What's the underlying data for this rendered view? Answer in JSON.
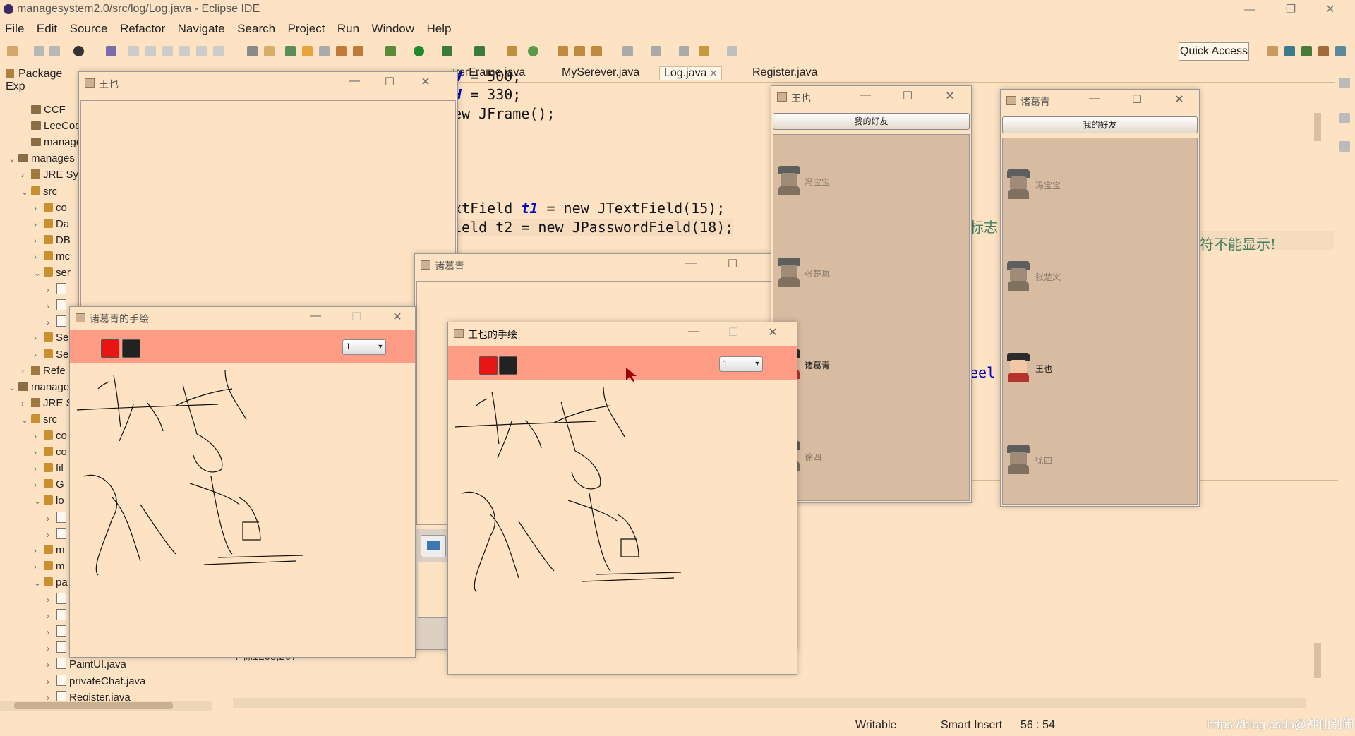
{
  "window": {
    "title": "managesystem2.0/src/log/Log.java - Eclipse IDE",
    "controls": [
      "—",
      "❐",
      "✕"
    ]
  },
  "menu": [
    "File",
    "Edit",
    "Source",
    "Refactor",
    "Navigate",
    "Search",
    "Project",
    "Run",
    "Window",
    "Help"
  ],
  "toolbar": {
    "quick_access": "Quick Access"
  },
  "package_explorer": {
    "tab_label": "Package Exp",
    "rows": [
      {
        "twisty": "",
        "icon": "proj",
        "label": "CCF"
      },
      {
        "twisty": "",
        "icon": "proj",
        "label": "LeeCode"
      },
      {
        "twisty": "",
        "icon": "proj",
        "label": "manages"
      },
      {
        "twisty": "⌄",
        "icon": "proj",
        "label": "manages"
      },
      {
        "twisty": "›",
        "icon": "jar",
        "label": "JRE Sy"
      },
      {
        "twisty": "⌄",
        "icon": "pkg",
        "label": "src"
      },
      {
        "twisty": "›",
        "icon": "pkg",
        "label": "co"
      },
      {
        "twisty": "›",
        "icon": "pkg",
        "label": "Da"
      },
      {
        "twisty": "›",
        "icon": "pkg",
        "label": "DB"
      },
      {
        "twisty": "›",
        "icon": "pkg",
        "label": "mc"
      },
      {
        "twisty": "⌄",
        "icon": "pkg",
        "label": "ser"
      },
      {
        "twisty": "›",
        "icon": "java",
        "label": ""
      },
      {
        "twisty": "›",
        "icon": "java",
        "label": ""
      },
      {
        "twisty": "›",
        "icon": "java",
        "label": ""
      },
      {
        "twisty": "›",
        "icon": "pkg",
        "label": "Se"
      },
      {
        "twisty": "›",
        "icon": "pkg",
        "label": "Se"
      },
      {
        "twisty": "›",
        "icon": "jar",
        "label": "Refe"
      },
      {
        "twisty": "⌄",
        "icon": "proj",
        "label": "manage"
      },
      {
        "twisty": "›",
        "icon": "jar",
        "label": "JRE S"
      },
      {
        "twisty": "⌄",
        "icon": "pkg",
        "label": "src"
      },
      {
        "twisty": "›",
        "icon": "pkg",
        "label": "co"
      },
      {
        "twisty": "›",
        "icon": "pkg",
        "label": "co"
      },
      {
        "twisty": "›",
        "icon": "pkg",
        "label": "fil"
      },
      {
        "twisty": "›",
        "icon": "pkg",
        "label": "G"
      },
      {
        "twisty": "⌄",
        "icon": "pkg",
        "label": "lo"
      },
      {
        "twisty": "›",
        "icon": "java",
        "label": ""
      },
      {
        "twisty": "›",
        "icon": "java",
        "label": ""
      },
      {
        "twisty": "›",
        "icon": "pkg",
        "label": "m"
      },
      {
        "twisty": "›",
        "icon": "pkg",
        "label": "m"
      },
      {
        "twisty": "⌄",
        "icon": "pkg",
        "label": "pa"
      },
      {
        "twisty": "›",
        "icon": "java",
        "label": ""
      },
      {
        "twisty": "›",
        "icon": "java",
        "label": ""
      },
      {
        "twisty": "›",
        "icon": "java",
        "label": ""
      },
      {
        "twisty": "›",
        "icon": "java",
        "label": ""
      },
      {
        "twisty": "›",
        "icon": "java",
        "label": "PaintUI.java"
      },
      {
        "twisty": "›",
        "icon": "java",
        "label": "privateChat.java"
      },
      {
        "twisty": "›",
        "icon": "java",
        "label": "Register.java"
      }
    ]
  },
  "editor": {
    "tabs": [
      "verFrame.java",
      "MySerever.java",
      "Log.java",
      "Register.java"
    ],
    "active_tab": "Log.java",
    "lines": [
      {
        "pre": "",
        "fld": "W",
        "post": " = 500;"
      },
      {
        "pre": "",
        "fld": "H",
        "post": " = 330;"
      },
      {
        "pre": "ew JFrame();",
        "fld": "",
        "post": ""
      },
      {
        "pre": "xtField ",
        "fld": "t1",
        "post": " = new JTextField(15);"
      },
      {
        "pre": "ield t2 = new JPasswordField(18);",
        "fld": "",
        "post": ""
      },
      {
        "pre": "eel",
        "fld": "",
        "post": ""
      }
    ],
    "comment_fragment_1": "标志",
    "comment_fragment_2": "符不能显示!"
  },
  "console": {
    "text": "坐标1208,207"
  },
  "status": {
    "writable": "Writable",
    "insert_mode": "Smart Insert",
    "position": "56 : 54"
  },
  "watermark": "https://blog.csdn@神仙别闹",
  "windows": {
    "wangye_chat": {
      "title": "王也"
    },
    "zhuge_chat": {
      "title": "诸葛青"
    },
    "zhuge_paint": {
      "title": "诸葛青的手绘",
      "size_value": "1"
    },
    "wangye_paint": {
      "title": "王也的手绘",
      "size_value": "1"
    },
    "wangye_friends": {
      "title": "王也",
      "button": "我的好友",
      "friends": [
        {
          "name": "冯宝宝",
          "online": false
        },
        {
          "name": "张楚岚",
          "online": false
        },
        {
          "name": "诸葛青",
          "online": true
        },
        {
          "name": "徐四",
          "online": false
        }
      ]
    },
    "zhuge_friends": {
      "title": "诸葛青",
      "button": "我的好友",
      "friends": [
        {
          "name": "冯宝宝",
          "online": false
        },
        {
          "name": "张楚岚",
          "online": false
        },
        {
          "name": "王也",
          "online": true
        },
        {
          "name": "徐四",
          "online": false
        }
      ]
    }
  },
  "colors": {
    "background": "#fde3c4",
    "paint_bar": "#ff9c86",
    "red_swatch": "#e81515",
    "black_swatch": "#222222"
  }
}
